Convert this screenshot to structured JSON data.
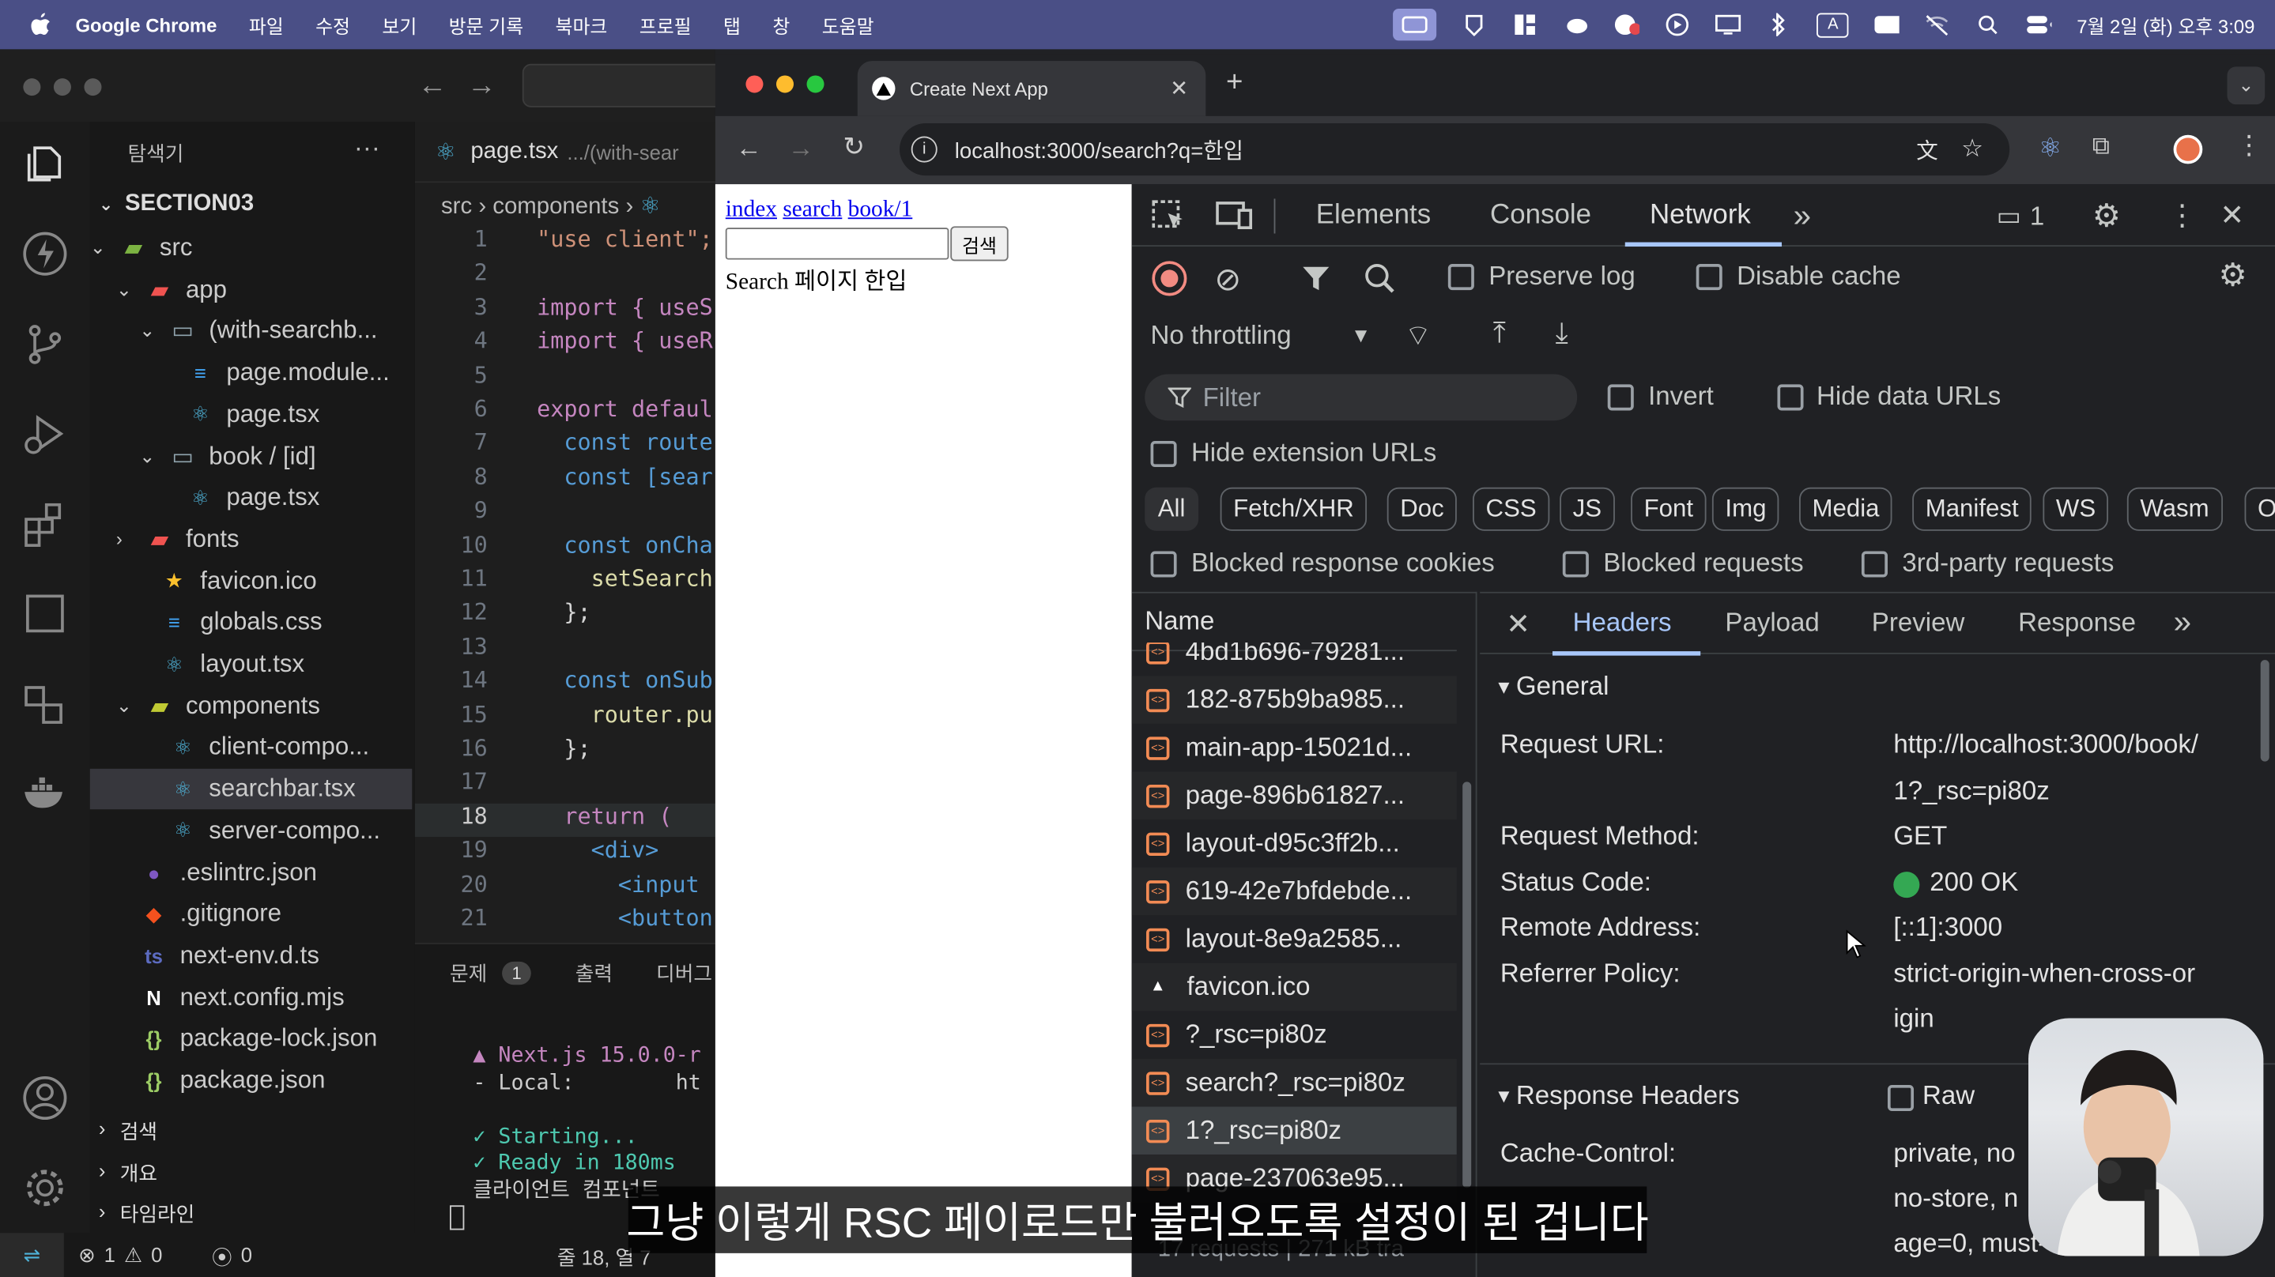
{
  "menubar": {
    "app": "Google Chrome",
    "items": [
      "파일",
      "수정",
      "보기",
      "방문 기록",
      "북마크",
      "프로필",
      "탭",
      "창",
      "도움말"
    ],
    "clock": "7월 2일 (화) 오후 3:09",
    "icons": [
      "apple-logo",
      "screen-share",
      "vpn",
      "app-grid",
      "weather",
      "record",
      "play",
      "display",
      "bluetooth",
      "input-A",
      "battery",
      "wifi-off",
      "spotlight",
      "control-center"
    ]
  },
  "vscode": {
    "explorer_title": "탐색기",
    "explorer_more": "···",
    "section": "SECTION03",
    "tree": [
      {
        "label": "src",
        "twisty": "down",
        "icon": "folder-src"
      },
      {
        "label": "app",
        "twisty": "down",
        "icon": "folder-app"
      },
      {
        "label": "(with-searchb...",
        "twisty": "down",
        "icon": "folder"
      },
      {
        "label": "page.module...",
        "twisty": "",
        "icon": "css-file"
      },
      {
        "label": "page.tsx",
        "twisty": "",
        "icon": "react-file"
      },
      {
        "label": "book / [id]",
        "twisty": "down",
        "icon": "folder"
      },
      {
        "label": "page.tsx",
        "twisty": "",
        "icon": "react-file"
      },
      {
        "label": "fonts",
        "twisty": "right",
        "icon": "folder-fonts"
      },
      {
        "label": "favicon.ico",
        "twisty": "",
        "icon": "star-file"
      },
      {
        "label": "globals.css",
        "twisty": "",
        "icon": "css-file"
      },
      {
        "label": "layout.tsx",
        "twisty": "",
        "icon": "react-file"
      },
      {
        "label": "components",
        "twisty": "down",
        "icon": "folder-components"
      },
      {
        "label": "client-compo...",
        "twisty": "",
        "icon": "react-file"
      },
      {
        "label": "searchbar.tsx",
        "twisty": "",
        "icon": "react-file"
      },
      {
        "label": "server-compo...",
        "twisty": "",
        "icon": "react-file"
      },
      {
        "label": ".eslintrc.json",
        "twisty": "",
        "icon": "eslint-file"
      },
      {
        "label": ".gitignore",
        "twisty": "",
        "icon": "git-file"
      },
      {
        "label": "next-env.d.ts",
        "twisty": "",
        "icon": "ts-file"
      },
      {
        "label": "next.config.mjs",
        "twisty": "",
        "icon": "next-file"
      },
      {
        "label": "package-lock.json",
        "twisty": "",
        "icon": "json-file"
      },
      {
        "label": "package.json",
        "twisty": "",
        "icon": "json-file"
      }
    ],
    "outline_sections": [
      "검색",
      "개요",
      "타임라인"
    ],
    "editor_tab": "page.tsx",
    "editor_tab_path": ".../(with-sear",
    "breadcrumb": [
      "src",
      "components"
    ],
    "code": [
      {
        "n": "1",
        "t": "\"use client\";"
      },
      {
        "n": "2",
        "t": ""
      },
      {
        "n": "3",
        "t": "import { useS"
      },
      {
        "n": "4",
        "t": "import { useR"
      },
      {
        "n": "5",
        "t": ""
      },
      {
        "n": "6",
        "t": "export defaul"
      },
      {
        "n": "7",
        "t": "  const route"
      },
      {
        "n": "8",
        "t": "  const [sear"
      },
      {
        "n": "9",
        "t": ""
      },
      {
        "n": "10",
        "t": "  const onCha"
      },
      {
        "n": "11",
        "t": "    setSearch"
      },
      {
        "n": "12",
        "t": "  };"
      },
      {
        "n": "13",
        "t": ""
      },
      {
        "n": "14",
        "t": "  const onSub"
      },
      {
        "n": "15",
        "t": "    router.pu"
      },
      {
        "n": "16",
        "t": "  };"
      },
      {
        "n": "17",
        "t": ""
      },
      {
        "n": "18",
        "t": "  return ("
      },
      {
        "n": "19",
        "t": "    <div>"
      },
      {
        "n": "20",
        "t": "      <input"
      },
      {
        "n": "21",
        "t": "      <button"
      }
    ],
    "active_line": "18",
    "panel_tabs": [
      "문제",
      "출력",
      "디버그"
    ],
    "problems_count": "1",
    "terminal": [
      "▲ Next.js 15.0.0-r",
      "- Local:        ht",
      "",
      "✓ Starting...",
      "✓ Ready in 180ms",
      "클라이언트 컴포넌트"
    ],
    "status": {
      "errors": "1",
      "warnings": "0",
      "ports": "0",
      "position": "줄 18, 열 7"
    }
  },
  "chrome": {
    "tab_title": "Create Next App",
    "url": "localhost:3000/search?q=한입",
    "page": {
      "links": [
        "index",
        "search",
        "book/1"
      ],
      "search_value": "",
      "search_button": "검색",
      "text": "Search 페이지 한입"
    },
    "devtools": {
      "tabs": [
        "Elements",
        "Console",
        "Network"
      ],
      "active_tab": "Network",
      "issues_count": "1",
      "preserve_log": "Preserve log",
      "disable_cache": "Disable cache",
      "throttling": "No throttling",
      "filter_placeholder": "Filter",
      "invert": "Invert",
      "hide_data_urls": "Hide data URLs",
      "hide_extension_urls": "Hide extension URLs",
      "type_filters": [
        "All",
        "Fetch/XHR",
        "Doc",
        "CSS",
        "JS",
        "Font",
        "Img",
        "Media",
        "Manifest",
        "WS",
        "Wasm",
        "O"
      ],
      "blocked_cookies": "Blocked response cookies",
      "blocked_requests": "Blocked requests",
      "third_party": "3rd-party requests",
      "name_header": "Name",
      "requests": [
        "4bd1b696-79281...",
        "182-875b9ba985...",
        "main-app-15021d...",
        "page-896b61827...",
        "layout-d95c3ff2b...",
        "619-42e7bfdebde...",
        "layout-8e9a2585...",
        "favicon.ico",
        "?_rsc=pi80z",
        "search?_rsc=pi80z",
        "1?_rsc=pi80z",
        "page-237063e95..."
      ],
      "selected_request": "1?_rsc=pi80z",
      "summary": "17 requests | 271 kB tra",
      "detail_tabs": [
        "Headers",
        "Payload",
        "Preview",
        "Response"
      ],
      "general_title": "General",
      "general": [
        {
          "k": "Request URL:",
          "v": [
            "http://localhost:3000/book/",
            "1?_rsc=pi80z"
          ]
        },
        {
          "k": "Request Method:",
          "v": [
            "GET"
          ]
        },
        {
          "k": "Status Code:",
          "v": [
            "200 OK"
          ]
        },
        {
          "k": "Remote Address:",
          "v": [
            "[::1]:3000"
          ]
        },
        {
          "k": "Referrer Policy:",
          "v": [
            "strict-origin-when-cross-or",
            "igin"
          ]
        }
      ],
      "response_headers_title": "Response Headers",
      "raw_label": "Raw",
      "response_headers": [
        {
          "k": "Cache-Control:",
          "v": [
            "private, no",
            "no-store, n",
            "age=0, must-"
          ]
        }
      ],
      "status_color": "#34a853"
    }
  },
  "subtitle": "그냥 이렇게 RSC 페이로드만 불러오도록 설정이 된 겁니다"
}
